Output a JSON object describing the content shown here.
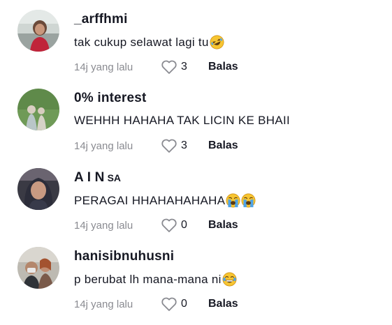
{
  "comments": [
    {
      "username": "_arffhmi",
      "username_suffix": "",
      "text": "tak cukup selawat lagi tu",
      "emojis": [
        "rolling-laughing-emoji"
      ],
      "time": "14j yang lalu",
      "likes": "3",
      "reply_label": "Balas"
    },
    {
      "username": "0% interest",
      "username_suffix": "",
      "text": "WEHHH HAHAHA TAK LICIN KE BHAII",
      "emojis": [],
      "time": "14j yang lalu",
      "likes": "3",
      "reply_label": "Balas"
    },
    {
      "username": "A I N",
      "username_suffix": "SA",
      "text": "PERAGAI HHAHAHAHAHA",
      "emojis": [
        "loudly-crying-emoji",
        "loudly-crying-emoji"
      ],
      "time": "14j yang lalu",
      "likes": "0",
      "reply_label": "Balas"
    },
    {
      "username": "hanisibnuhusni",
      "username_suffix": "",
      "text": "p berubat lh mana-mana ni",
      "emojis": [
        "tears-of-joy-emoji"
      ],
      "time": "14j yang lalu",
      "likes": "0",
      "reply_label": "Balas"
    }
  ],
  "colors": {
    "text": "#161823",
    "muted": "#8a8b91",
    "emoji_yellow": "#f7c531",
    "tear_blue": "#4fa3e6"
  },
  "icons": {
    "like": "heart-outline-icon"
  }
}
